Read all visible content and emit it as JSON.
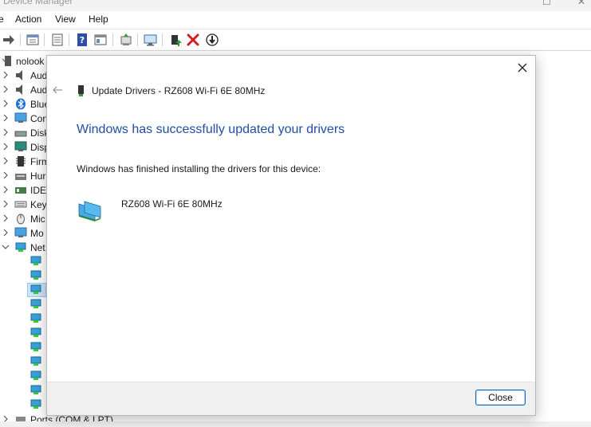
{
  "window": {
    "title": "Device Manager"
  },
  "menu": {
    "items": [
      "e",
      "Action",
      "View",
      "Help"
    ]
  },
  "toolbar": {
    "icons": [
      "forward-arrow-icon",
      "properties-icon",
      "list-icon",
      "help-icon",
      "details-icon",
      "update-driver-icon",
      "scan-hardware-icon",
      "enable-device-icon",
      "uninstall-icon",
      "disable-device-icon"
    ]
  },
  "tree": {
    "root_label": "nolook",
    "categories": [
      {
        "label": "Aud",
        "icon": "speaker-icon"
      },
      {
        "label": "Aud",
        "icon": "speaker-icon"
      },
      {
        "label": "Blue",
        "icon": "bluetooth-icon"
      },
      {
        "label": "Con",
        "icon": "monitor-icon"
      },
      {
        "label": "Disk",
        "icon": "disk-icon"
      },
      {
        "label": "Disp",
        "icon": "display-icon"
      },
      {
        "label": "Firm",
        "icon": "firmware-icon"
      },
      {
        "label": "Hur",
        "icon": "hid-icon"
      },
      {
        "label": "IDE",
        "icon": "ide-icon"
      },
      {
        "label": "Key",
        "icon": "keyboard-icon"
      },
      {
        "label": "Mic",
        "icon": "mouse-icon"
      },
      {
        "label": "Mo",
        "icon": "monitor-icon"
      },
      {
        "label": "Net",
        "icon": "network-icon"
      }
    ],
    "bottom_label": "Ports (COM & LPT)"
  },
  "dialog": {
    "header": "Update Drivers - RZ608 Wi-Fi 6E 80MHz",
    "heading": "Windows has successfully updated your drivers",
    "description": "Windows has finished installing the drivers for this device:",
    "device_name": "RZ608 Wi-Fi 6E 80MHz",
    "close_label": "Close"
  },
  "colors": {
    "heading": "#1f4ea6",
    "accent": "#0067c0",
    "uninstall": "#d11f1f"
  }
}
